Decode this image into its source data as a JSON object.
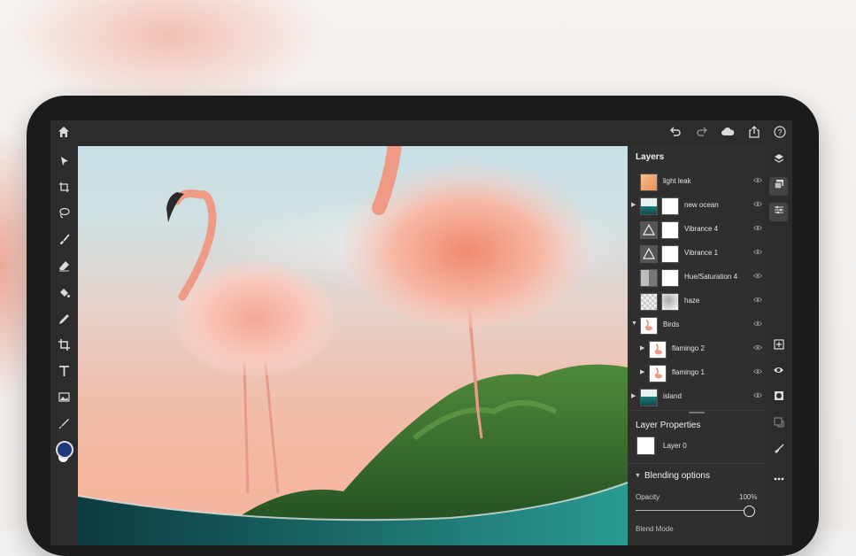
{
  "toolbar_top": {
    "left_icons": [
      "home-icon"
    ],
    "right_icons": [
      "undo-icon",
      "redo-icon",
      "cloud-icon",
      "share-icon",
      "help-icon"
    ]
  },
  "left_tools": [
    "select-icon",
    "transform-icon",
    "lasso-icon",
    "brush-icon",
    "eraser-icon",
    "fill-icon",
    "healing-icon",
    "crop-icon",
    "type-icon",
    "image-icon",
    "eyedropper-icon"
  ],
  "colors": {
    "foreground": "#1f3a7a",
    "background": "#ffffff",
    "panel": "#2f2f2f",
    "canvas_sky": "#c9dfe7",
    "canvas_sunset": "#f4b49b"
  },
  "layers_panel": {
    "title": "Layers",
    "layers": [
      {
        "name": "light leak",
        "indent": 0,
        "expandable": false
      },
      {
        "name": "new ocean",
        "indent": 0,
        "expandable": true
      },
      {
        "name": "Vibrance 4",
        "indent": 0,
        "expandable": false
      },
      {
        "name": "Vibrance 1",
        "indent": 0,
        "expandable": false
      },
      {
        "name": "Hue/Saturation 4",
        "indent": 0,
        "expandable": false
      },
      {
        "name": "haze",
        "indent": 0,
        "expandable": false
      },
      {
        "name": "Birds",
        "indent": 0,
        "expandable": true
      },
      {
        "name": "flamingo 2",
        "indent": 1,
        "expandable": true
      },
      {
        "name": "flamingo 1",
        "indent": 1,
        "expandable": true
      },
      {
        "name": "island",
        "indent": 0,
        "expandable": true
      }
    ]
  },
  "layer_properties": {
    "title": "Layer Properties",
    "layer_name": "Layer 0"
  },
  "blending": {
    "title": "Blending options",
    "opacity_label": "Opacity",
    "opacity_value": "100%",
    "opacity_fraction": 1.0,
    "blend_mode_label": "Blend Mode"
  },
  "right_tools": [
    "layers-icon",
    "layer-stack-icon",
    "adjustments-icon",
    "add-layer-icon",
    "visibility-icon",
    "mask-icon",
    "clip-icon",
    "sweep-icon",
    "more-icon"
  ]
}
